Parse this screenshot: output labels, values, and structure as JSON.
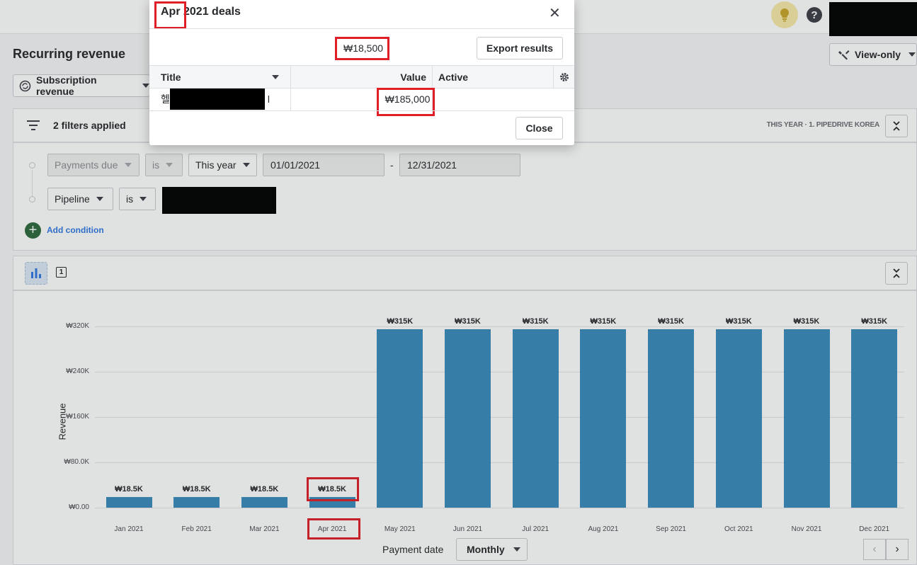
{
  "header": {
    "help_glyph": "?"
  },
  "page": {
    "title": "Recurring revenue",
    "view_mode": "View-only",
    "report_type": "Subscription revenue"
  },
  "filters": {
    "summary": "2 filters applied",
    "meta": "THIS YEAR  ·  1. PIPEDRIVE KOREA",
    "row1": {
      "field": "Payments due",
      "operator": "is",
      "period": "This year",
      "from": "01/01/2021",
      "separator": "-",
      "to": "12/31/2021"
    },
    "row2": {
      "field": "Pipeline",
      "operator": "is"
    },
    "add_condition": "Add condition"
  },
  "chart_panel": {
    "badge": "1"
  },
  "chart_data": {
    "type": "bar",
    "categories": [
      "Jan 2021",
      "Feb 2021",
      "Mar 2021",
      "Apr 2021",
      "May 2021",
      "Jun 2021",
      "Jul 2021",
      "Aug 2021",
      "Sep 2021",
      "Oct 2021",
      "Nov 2021",
      "Dec 2021"
    ],
    "values": [
      18500,
      18500,
      18500,
      18500,
      315000,
      315000,
      315000,
      315000,
      315000,
      315000,
      315000,
      315000
    ],
    "data_labels": [
      "₩18.5K",
      "₩18.5K",
      "₩18.5K",
      "₩18.5K",
      "₩315K",
      "₩315K",
      "₩315K",
      "₩315K",
      "₩315K",
      "₩315K",
      "₩315K",
      "₩315K"
    ],
    "yticks": [
      0,
      80000,
      160000,
      240000,
      320000
    ],
    "ytick_labels": [
      "₩0.00",
      "₩80.0K",
      "₩160K",
      "₩240K",
      "₩320K"
    ],
    "ylim": [
      0,
      320000
    ],
    "ylabel": "Revenue",
    "xlabel": "Payment date",
    "grid": true,
    "color": "#3a8bbc"
  },
  "chart_controls": {
    "interval": "Monthly",
    "prev": "‹",
    "next": "›"
  },
  "modal": {
    "title": "Apr 2021 deals",
    "total": "₩18,500",
    "export_label": "Export results",
    "columns": [
      "Title",
      "Value",
      "Active"
    ],
    "rows": [
      {
        "title_visible": "헬",
        "title_tail": "l",
        "value": "₩185,000",
        "active": ""
      }
    ],
    "close_label": "Close",
    "close_glyph": "✕"
  }
}
